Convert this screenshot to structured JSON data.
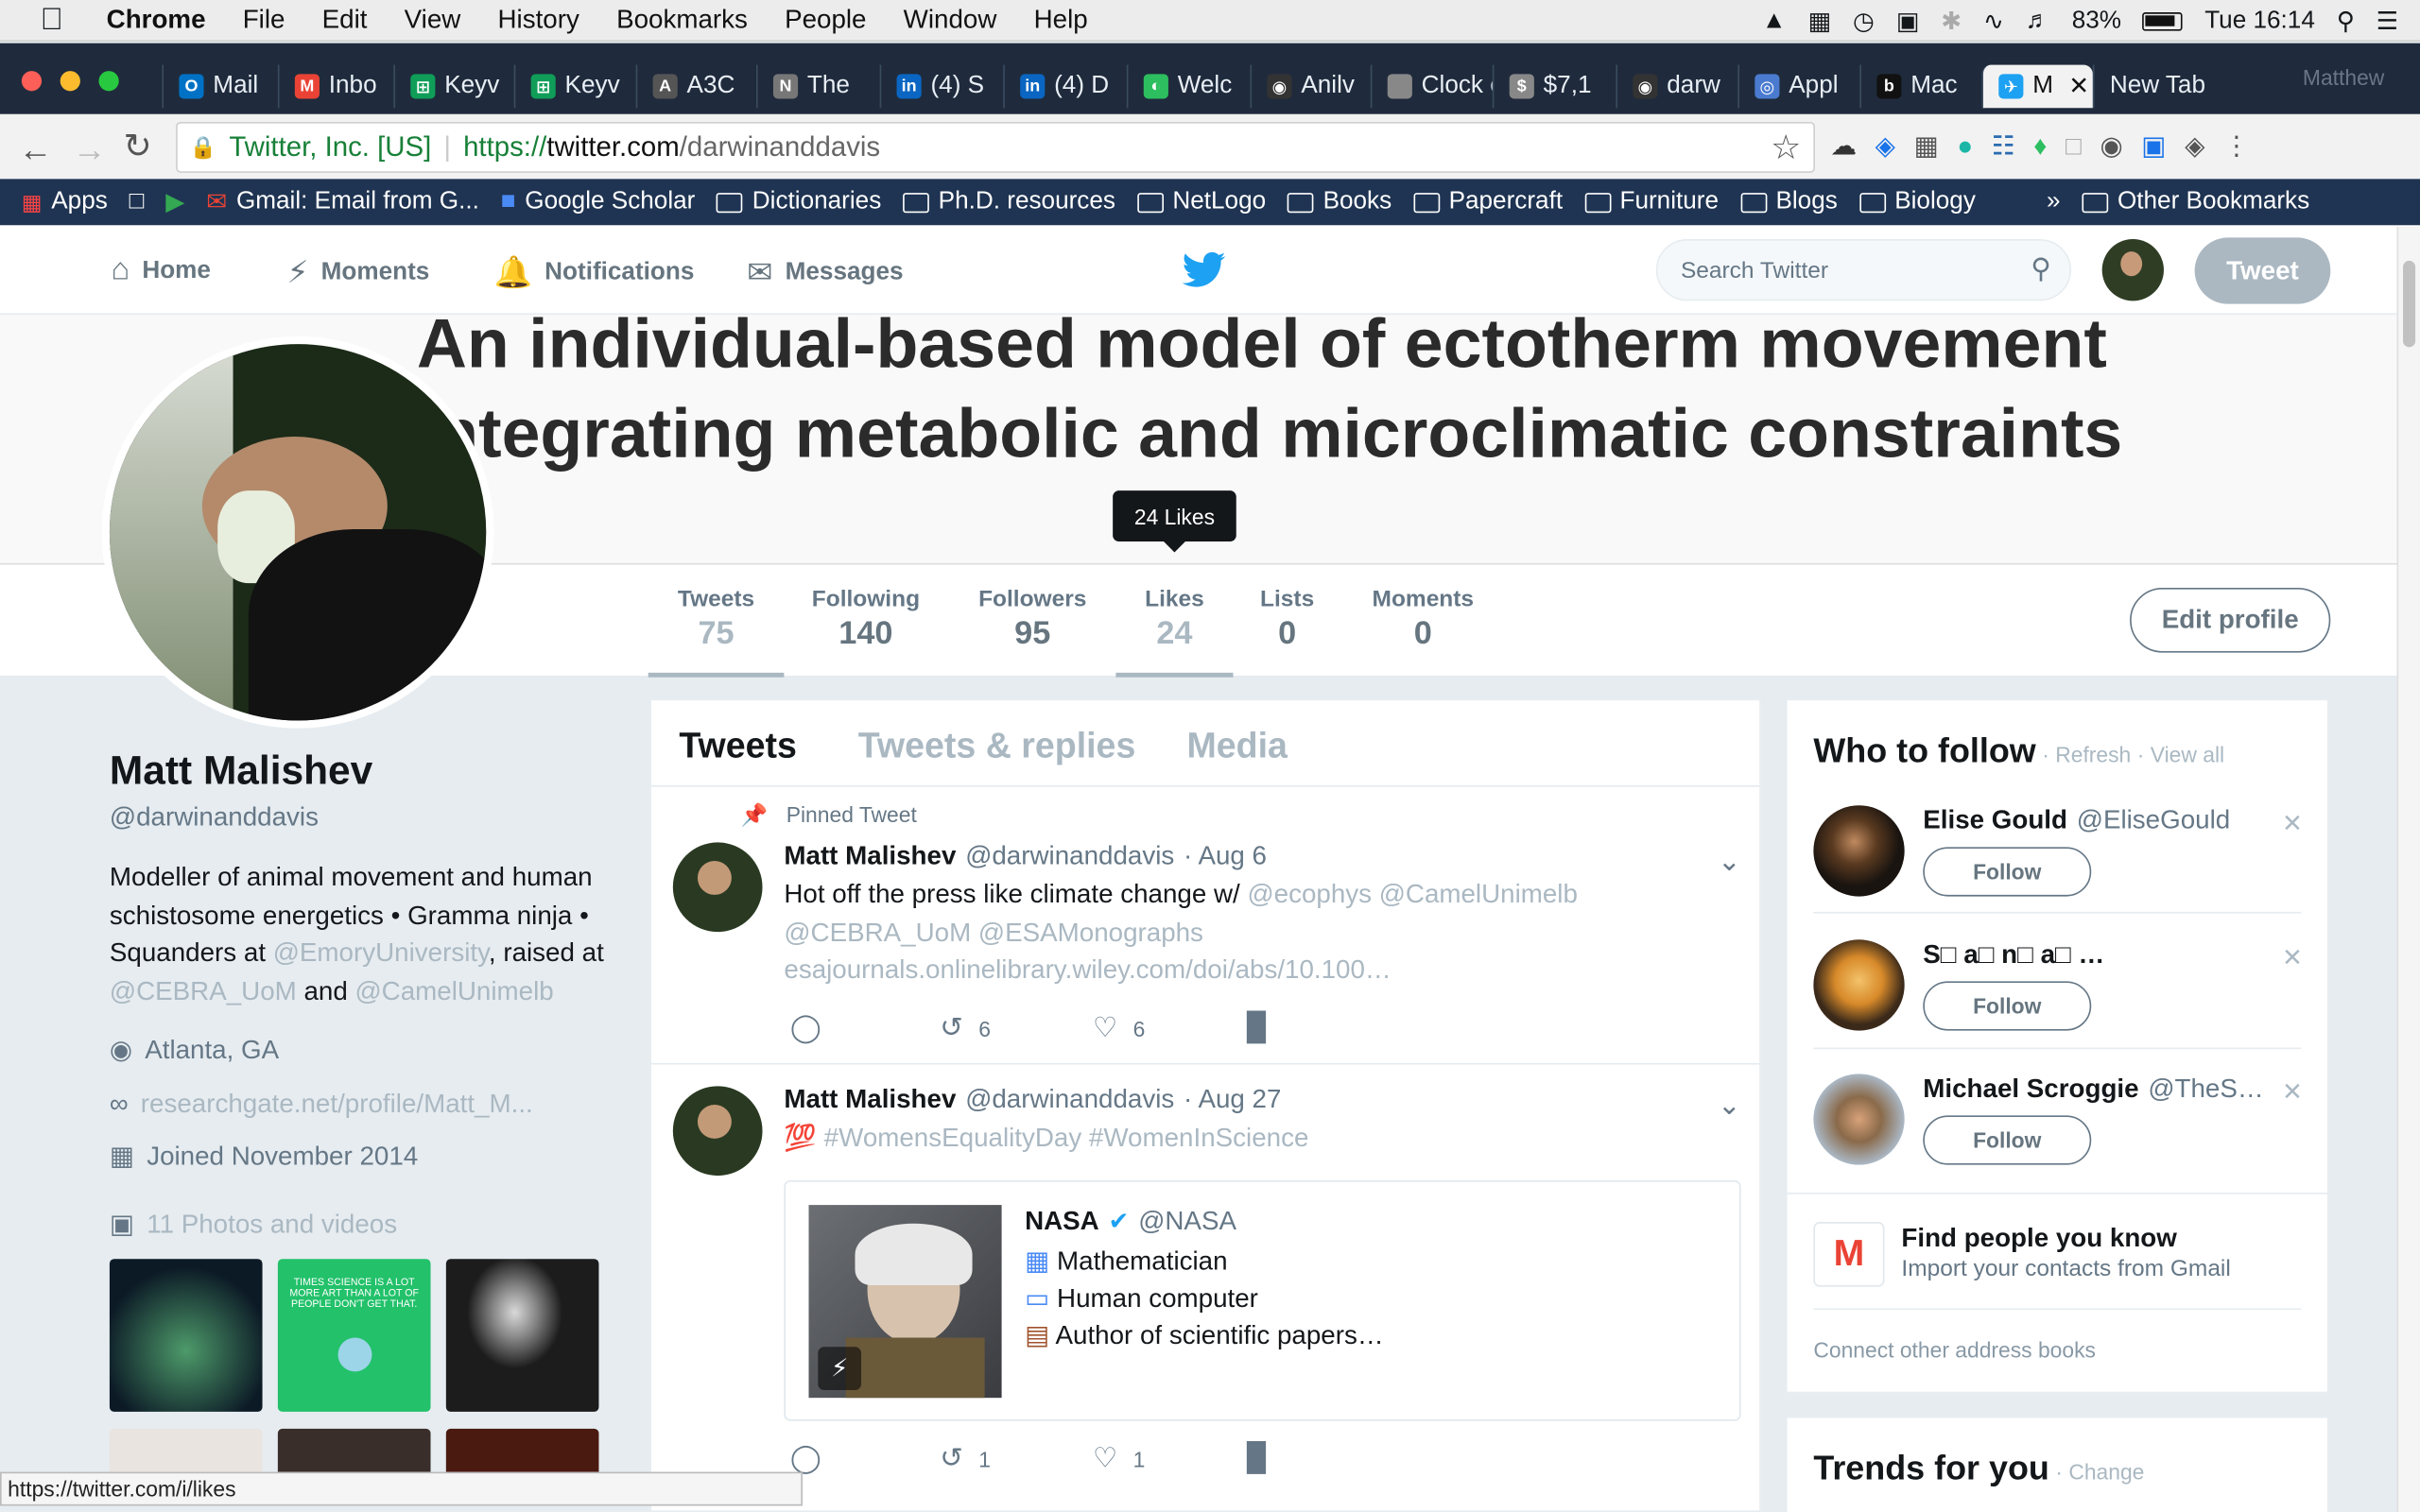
{
  "os_menubar": {
    "app": "Chrome",
    "menus": [
      "File",
      "Edit",
      "View",
      "History",
      "Bookmarks",
      "People",
      "Window",
      "Help"
    ],
    "battery": "83%",
    "clock": "Tue 16:14"
  },
  "browser": {
    "tabs": [
      "Mail",
      "Inbo",
      "Keyv",
      "Keyv",
      "A3C",
      "The",
      "(4) S",
      "(4) D",
      "Welc",
      "Anilv",
      "Clock e",
      "$7,1",
      "darw",
      "Appl",
      "Mac",
      "M",
      "New Tab"
    ],
    "profile_name": "Matthew",
    "security_label": "Twitter, Inc. [US]",
    "url_scheme": "https://",
    "url_host": "twitter.com",
    "url_path": "/darwinanddavis",
    "bookmarks": [
      "Apps",
      "Gmail: Email from G...",
      "Google Scholar",
      "Dictionaries",
      "Ph.D. resources",
      "NetLogo",
      "Books",
      "Papercraft",
      "Furniture",
      "Blogs",
      "Biology",
      "»",
      "Other Bookmarks"
    ],
    "status_url": "https://twitter.com/i/likes"
  },
  "twitter_nav": {
    "home": "Home",
    "moments": "Moments",
    "notifications": "Notifications",
    "messages": "Messages",
    "search_placeholder": "Search Twitter",
    "tweet_button": "Tweet"
  },
  "banner": {
    "text": "An individual-based model of ectotherm movement integrating metabolic and microclimatic constraints"
  },
  "profile_nav": {
    "stats": [
      {
        "label": "Tweets",
        "value": "75"
      },
      {
        "label": "Following",
        "value": "140"
      },
      {
        "label": "Followers",
        "value": "95"
      },
      {
        "label": "Likes",
        "value": "24"
      },
      {
        "label": "Lists",
        "value": "0"
      },
      {
        "label": "Moments",
        "value": "0"
      }
    ],
    "tooltip": "24 Likes",
    "edit_profile": "Edit profile"
  },
  "profile": {
    "name": "Matt Malishev",
    "handle": "@darwinanddavis",
    "bio_1": "Modeller of animal movement and human schistosome energetics • Gramma ninja • Squanders at ",
    "bio_link_1": "@EmoryUniversity",
    "bio_2": ", raised at ",
    "bio_link_2": "@CEBRA_UoM",
    "bio_3": " and ",
    "bio_link_3": "@CamelUnimelb",
    "location": "Atlanta, GA",
    "website": "researchgate.net/profile/Matt_M...",
    "joined": "Joined November 2014",
    "photos": "11 Photos and videos",
    "photo_thumb_2_text": "TIMES SCIENCE IS A LOT MORE ART THAN A LOT OF PEOPLE DON'T GET THAT."
  },
  "timeline": {
    "tabs": [
      "Tweets",
      "Tweets & replies",
      "Media"
    ],
    "tweets": [
      {
        "pinned_label": "Pinned Tweet",
        "name": "Matt Malishev",
        "handle": "@darwinanddavis",
        "date": "· Aug 6",
        "text": "Hot off the press like climate change w/ ",
        "mentions": "@ecophys @CamelUnimelb @CEBRA_UoM @ESAMonographs",
        "link": "esajournals.onlinelibrary.wiley.com/doi/abs/10.100…",
        "retweets": "6",
        "likes": "6"
      },
      {
        "name": "Matt Malishev",
        "handle": "@darwinanddavis",
        "date": "· Aug 27",
        "emoji": "💯",
        "hashtags": "#WomensEqualityDay #WomenInScience",
        "quote_name": "NASA",
        "quote_handle": "@NASA",
        "quote_lines": [
          "Mathematician",
          "Human computer",
          "Author of scientific papers…"
        ],
        "retweets": "1",
        "likes": "1"
      }
    ]
  },
  "who_to_follow": {
    "title": "Who to follow",
    "refresh": "· Refresh",
    "view_all": "· View all",
    "users": [
      {
        "name": "Elise Gould",
        "handle": "@EliseGould",
        "button": "Follow"
      },
      {
        "name": "S□ a□ n□ a□ …",
        "handle": "",
        "button": "Follow"
      },
      {
        "name": "Michael Scroggie",
        "handle": "@TheS…",
        "button": "Follow"
      }
    ],
    "find_people_title": "Find people you know",
    "find_people_sub": "Import your contacts from Gmail",
    "connect_other": "Connect other address books"
  },
  "trends": {
    "title": "Trends for you",
    "change": "· Change"
  },
  "colors": {
    "twitter_blue": "#1da1f2",
    "link_gray": "#aab8c2",
    "text_gray": "#657786",
    "chrome_dark": "#1f2b3c"
  }
}
